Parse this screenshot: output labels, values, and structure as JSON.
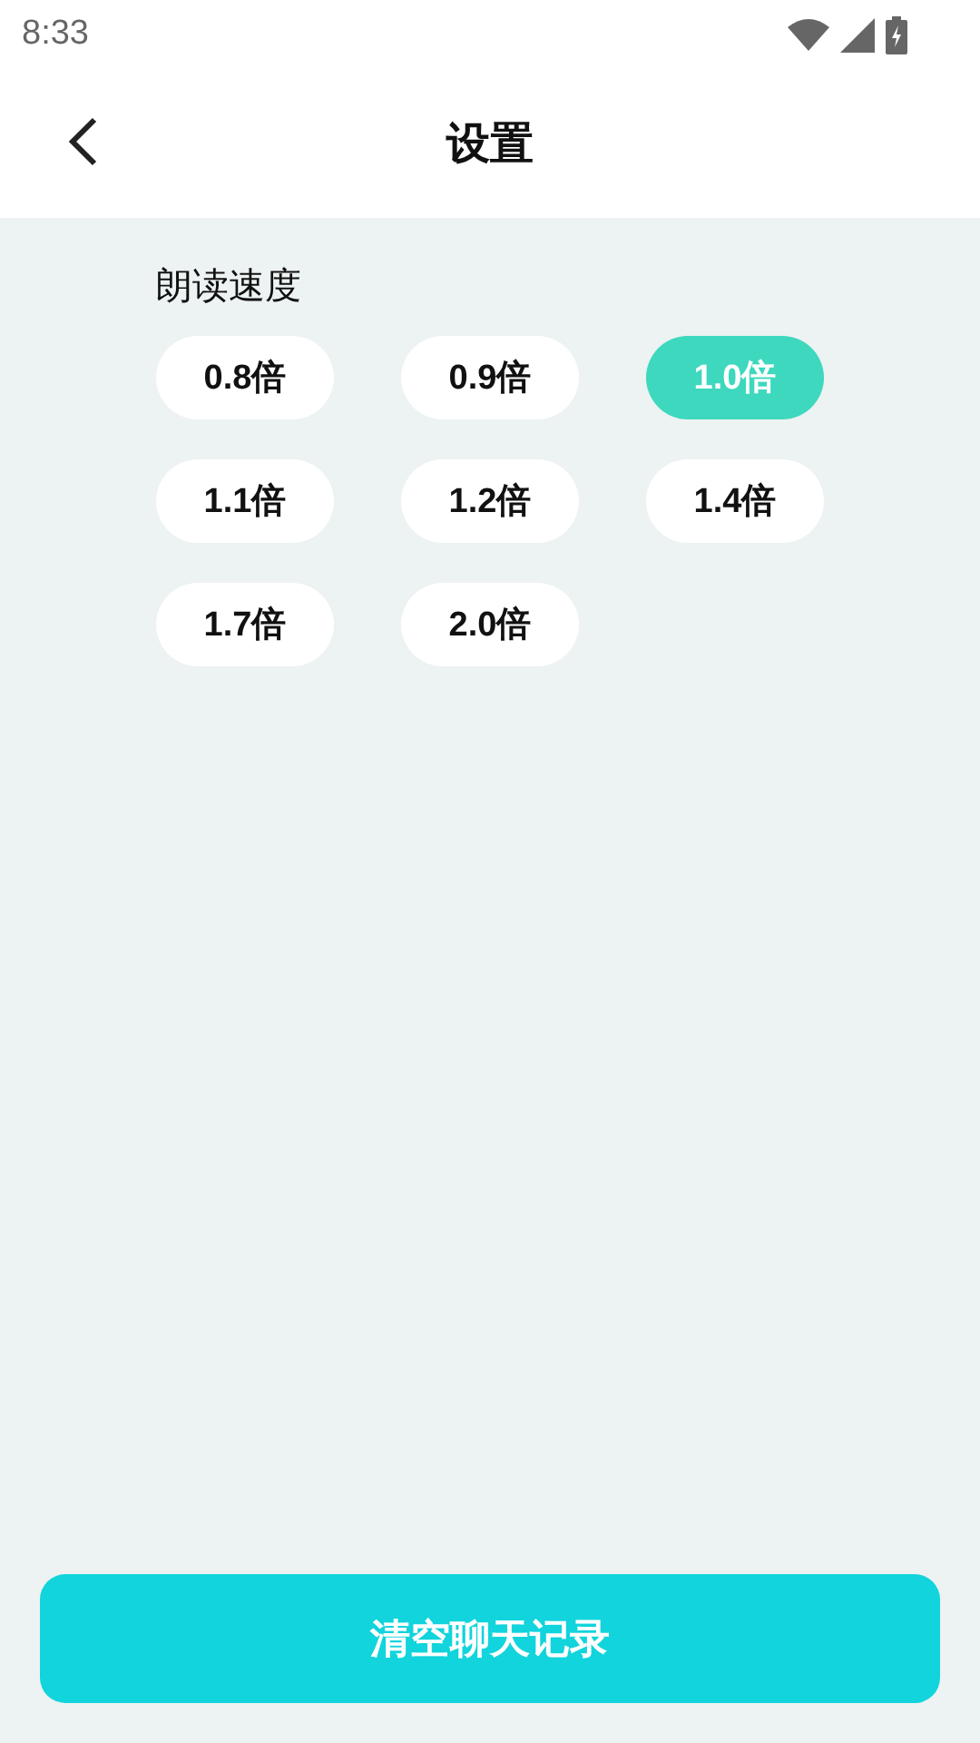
{
  "status_bar": {
    "time": "8:33"
  },
  "header": {
    "title": "设置"
  },
  "reading_speed": {
    "label": "朗读速度",
    "options": [
      {
        "label": "0.8倍",
        "selected": false
      },
      {
        "label": "0.9倍",
        "selected": false
      },
      {
        "label": "1.0倍",
        "selected": true
      },
      {
        "label": "1.1倍",
        "selected": false
      },
      {
        "label": "1.2倍",
        "selected": false
      },
      {
        "label": "1.4倍",
        "selected": false
      },
      {
        "label": "1.7倍",
        "selected": false
      },
      {
        "label": "2.0倍",
        "selected": false
      }
    ]
  },
  "clear_button": {
    "label": "清空聊天记录"
  }
}
